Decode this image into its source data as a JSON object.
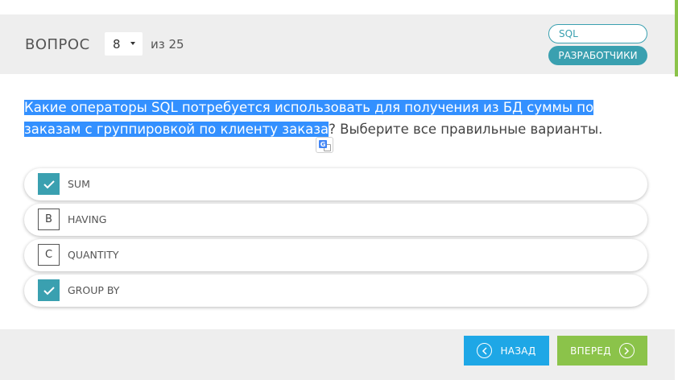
{
  "header": {
    "question_label": "ВОПРОС",
    "question_number": "8",
    "of_total": "из 25",
    "tags": [
      "SQL",
      "РАЗРАБОТЧИКИ"
    ]
  },
  "question": {
    "text_highlighted": "Какие операторы SQL потребуется использовать для получения из БД суммы по заказам с группировкой по клиенту заказа",
    "text_rest": "? Выберите все правильные варианты."
  },
  "options": [
    {
      "marker": "",
      "label": "SUM",
      "checked": true
    },
    {
      "marker": "B",
      "label": "HAVING",
      "checked": false
    },
    {
      "marker": "C",
      "label": "QUANTITY",
      "checked": false
    },
    {
      "marker": "",
      "label": "GROUP BY",
      "checked": true
    }
  ],
  "footer": {
    "back_label": "НАЗАД",
    "next_label": "ВПЕРЕД"
  },
  "colors": {
    "accent_teal": "#3aa0b0",
    "back_button": "#1ea7e6",
    "next_button": "#8bc34a",
    "selection": "#3390ff"
  },
  "icons": {
    "check": "check-icon",
    "back": "chevron-left-icon",
    "next": "chevron-right-icon",
    "translate": "google-translate-icon"
  }
}
